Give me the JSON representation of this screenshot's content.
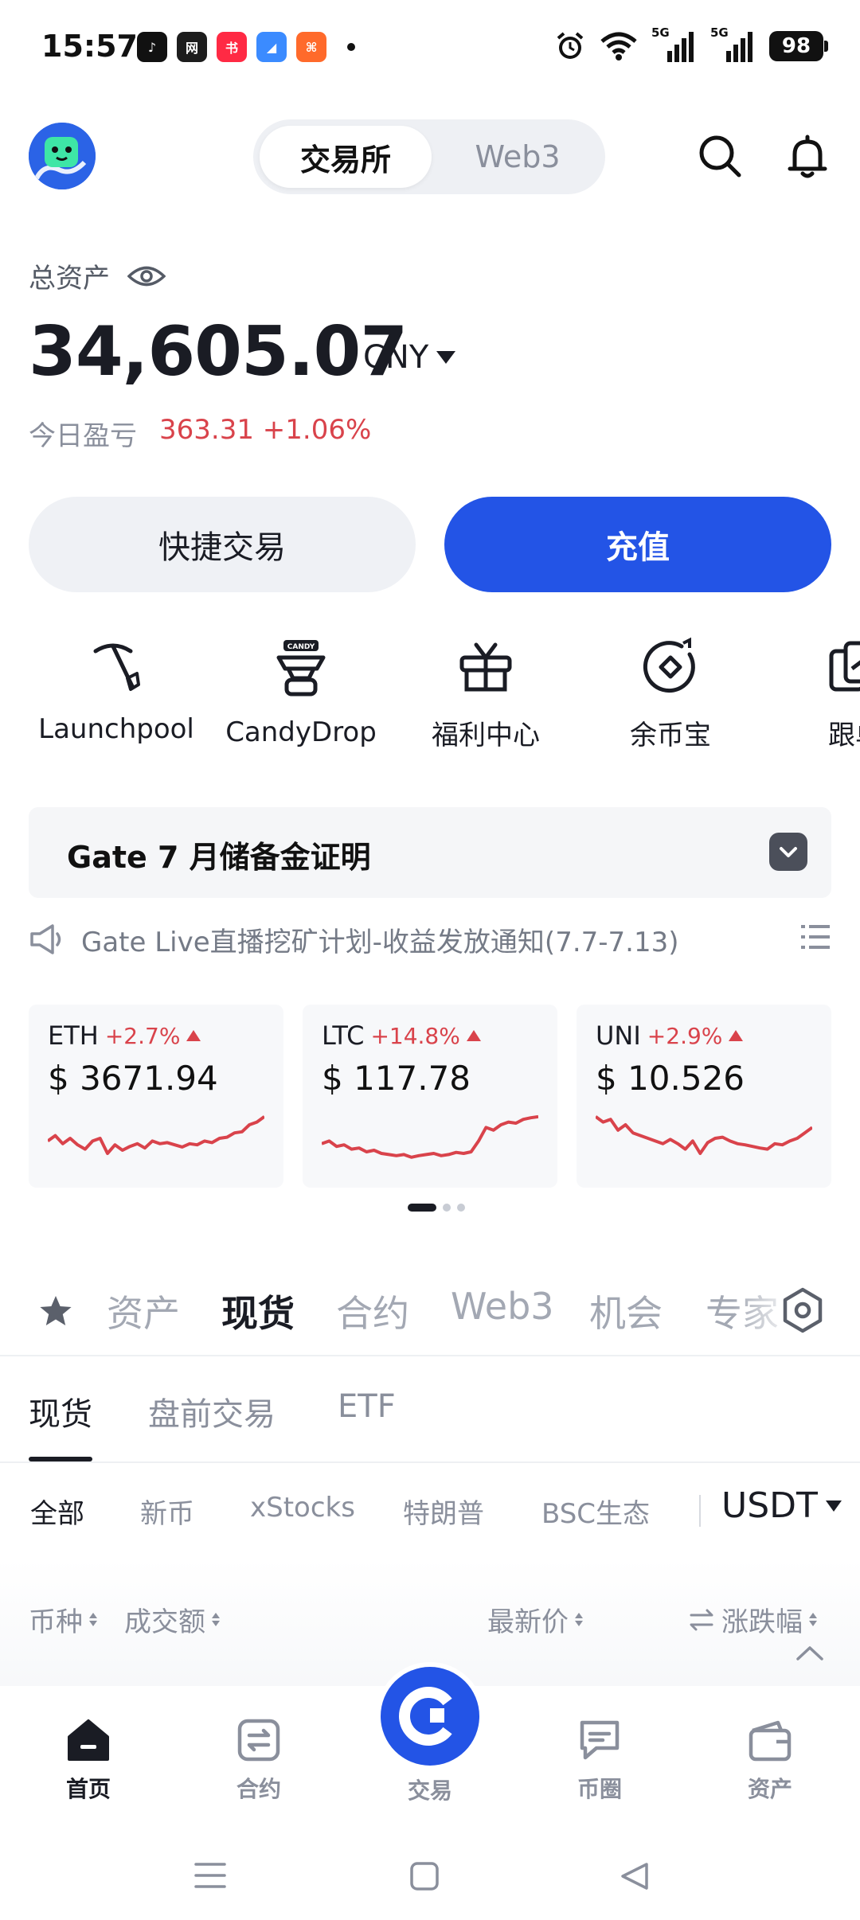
{
  "status_bar": {
    "time": "15:57",
    "apps": [
      {
        "icon": "tiktok-icon",
        "color": "#111111",
        "glyph": "♪"
      },
      {
        "icon": "news-app-icon",
        "color": "#1d1d1d",
        "glyph": "网"
      },
      {
        "icon": "red-note-icon",
        "color": "#ff2a44",
        "glyph": "书"
      },
      {
        "icon": "blue-app-icon",
        "color": "#3b8bff",
        "glyph": "◢"
      },
      {
        "icon": "orange-app-icon",
        "color": "#ff6a2b",
        "glyph": "⌘"
      }
    ],
    "network_5g_1": "5G",
    "network_5g_2": "5G",
    "battery": "98"
  },
  "header": {
    "seg_active": "交易所",
    "seg_inactive": "Web3"
  },
  "assets": {
    "label": "总资产",
    "value": "34,605.07",
    "currency": "CNY",
    "pnl_label": "今日盈亏",
    "pnl_value": "363.31 +1.06%"
  },
  "actions": {
    "quick_trade": "快捷交易",
    "deposit": "充值"
  },
  "entries": [
    "Launchpool",
    "CandyDrop",
    "福利中心",
    "余币宝",
    "跟单"
  ],
  "candy_badge": "CANDY",
  "reserve_banner": "Gate 7 月储备金证明",
  "notice": "Gate Live直播挖矿计划-收益发放通知(7.7-7.13)",
  "tickers": [
    {
      "symbol": "ETH",
      "change": "+2.7%",
      "price": "$ 3671.94",
      "spark": [
        0.55,
        0.45,
        0.6,
        0.5,
        0.62,
        0.7,
        0.55,
        0.5,
        0.78,
        0.62,
        0.72,
        0.65,
        0.6,
        0.68,
        0.55,
        0.6,
        0.58,
        0.62,
        0.66,
        0.6,
        0.62,
        0.55,
        0.58,
        0.5,
        0.48,
        0.4,
        0.38,
        0.25,
        0.2,
        0.1
      ]
    },
    {
      "symbol": "LTC",
      "change": "+14.8%",
      "price": "$ 117.78",
      "spark": [
        0.6,
        0.55,
        0.65,
        0.62,
        0.7,
        0.68,
        0.75,
        0.72,
        0.78,
        0.8,
        0.82,
        0.8,
        0.85,
        0.82,
        0.8,
        0.78,
        0.82,
        0.8,
        0.76,
        0.78,
        0.75,
        0.55,
        0.3,
        0.35,
        0.25,
        0.2,
        0.22,
        0.15,
        0.12,
        0.1
      ]
    },
    {
      "symbol": "UNI",
      "change": "+2.9%",
      "price": "$ 10.526",
      "spark": [
        0.1,
        0.2,
        0.15,
        0.35,
        0.25,
        0.4,
        0.45,
        0.5,
        0.55,
        0.6,
        0.52,
        0.6,
        0.7,
        0.55,
        0.78,
        0.58,
        0.5,
        0.48,
        0.55,
        0.6,
        0.62,
        0.65,
        0.68,
        0.7,
        0.6,
        0.62,
        0.55,
        0.5,
        0.4,
        0.3
      ]
    }
  ],
  "main_tabs": [
    "资产",
    "现货",
    "合约",
    "Web3",
    "机会",
    "专家"
  ],
  "sub_tabs": [
    "现货",
    "盘前交易",
    "ETF"
  ],
  "filters": [
    "全部",
    "新币",
    "xStocks",
    "特朗普",
    "BSC生态"
  ],
  "quote_currency": "USDT",
  "columns": {
    "coin": "币种",
    "volume": "成交额",
    "last_price": "最新价",
    "change": "涨跌幅"
  },
  "bottom_nav": [
    "首页",
    "合约",
    "交易",
    "币圈",
    "资产"
  ],
  "colors": {
    "brand_blue": "#2354e6",
    "up_red": "#d9434b"
  }
}
